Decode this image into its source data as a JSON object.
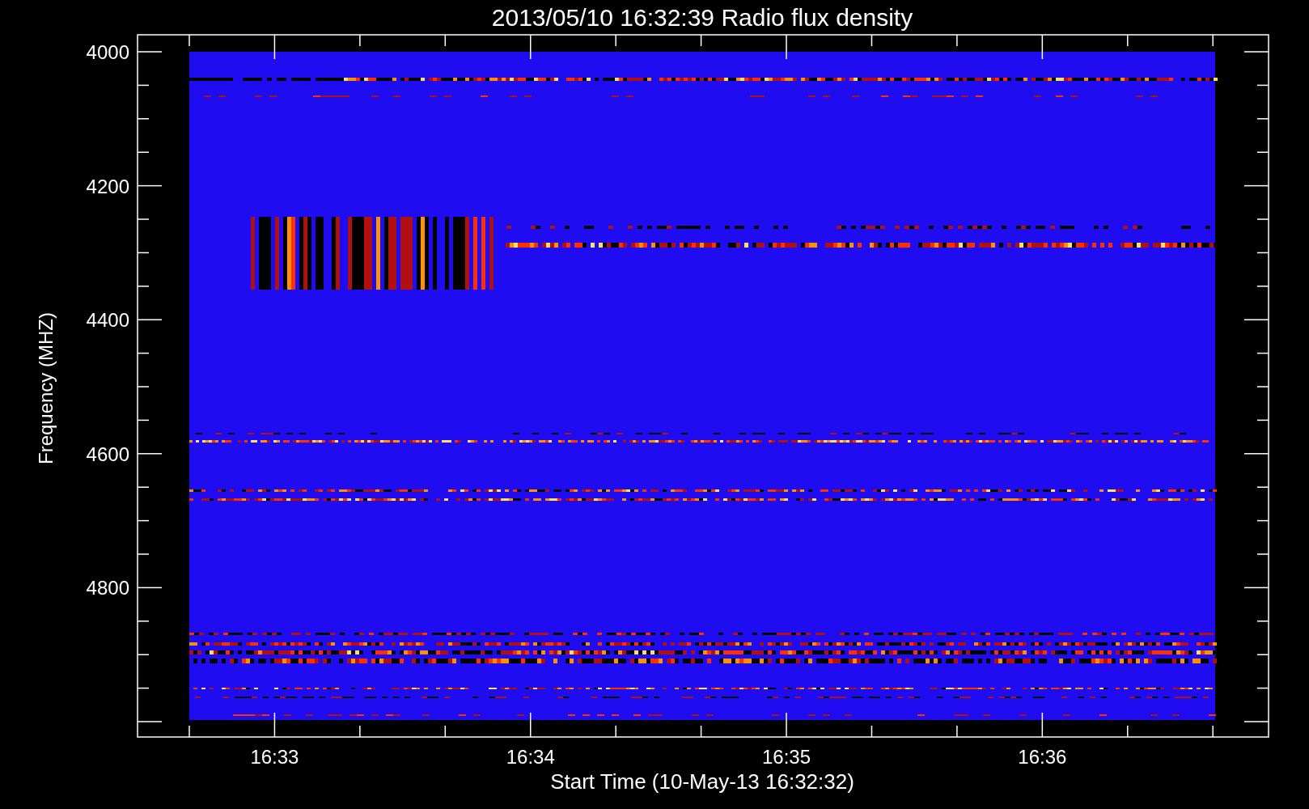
{
  "title": "2013/05/10 16:32:39 Radio flux density",
  "y_axis": {
    "label": "Frequency (MHZ)",
    "ticks": [
      "4000",
      "4200",
      "4400",
      "4600",
      "4800"
    ]
  },
  "x_axis": {
    "label": "Start Time (10-May-13 16:32:32)",
    "ticks": [
      "16:33",
      "16:34",
      "16:35",
      "16:36"
    ]
  }
}
